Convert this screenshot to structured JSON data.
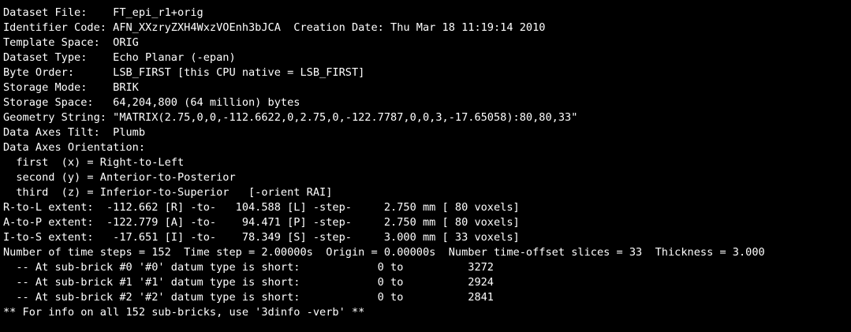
{
  "terminal": {
    "lines": [
      "Dataset File:    FT_epi_r1+orig",
      "Identifier Code: AFN_XXzryZXH4WxzVOEnh3bJCA  Creation Date: Thu Mar 18 11:19:14 2010",
      "Template Space:  ORIG",
      "Dataset Type:    Echo Planar (-epan)",
      "Byte Order:      LSB_FIRST [this CPU native = LSB_FIRST]",
      "Storage Mode:    BRIK",
      "Storage Space:   64,204,800 (64 million) bytes",
      "Geometry String: \"MATRIX(2.75,0,0,-112.6622,0,2.75,0,-122.7787,0,0,3,-17.65058):80,80,33\"",
      "Data Axes Tilt:  Plumb",
      "Data Axes Orientation:",
      "  first  (x) = Right-to-Left",
      "  second (y) = Anterior-to-Posterior",
      "  third  (z) = Inferior-to-Superior   [-orient RAI]",
      "R-to-L extent:  -112.662 [R] -to-   104.588 [L] -step-     2.750 mm [ 80 voxels]",
      "A-to-P extent:  -122.779 [A] -to-    94.471 [P] -step-     2.750 mm [ 80 voxels]",
      "I-to-S extent:   -17.651 [I] -to-    78.349 [S] -step-     3.000 mm [ 33 voxels]",
      "Number of time steps = 152  Time step = 2.00000s  Origin = 0.00000s  Number time-offset slices = 33  Thickness = 3.000",
      "  -- At sub-brick #0 '#0' datum type is short:            0 to          3272",
      "  -- At sub-brick #1 '#1' datum type is short:            0 to          2924",
      "  -- At sub-brick #2 '#2' datum type is short:            0 to          2841",
      "** For info on all 152 sub-bricks, use '3dinfo -verb' **"
    ]
  }
}
